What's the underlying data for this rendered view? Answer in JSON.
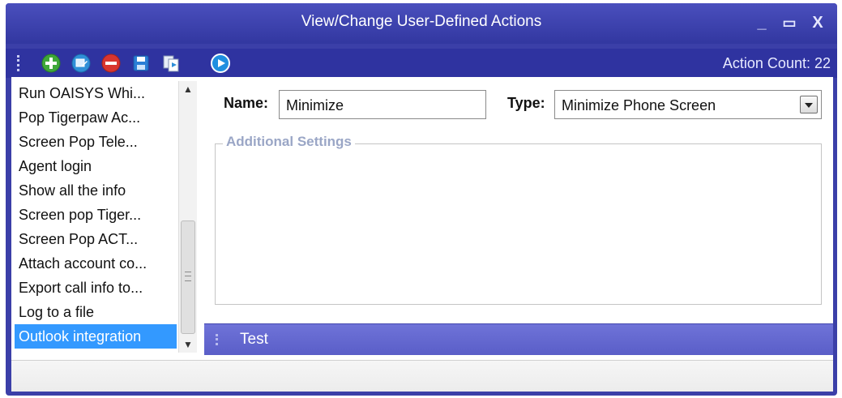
{
  "window": {
    "title": "View/Change User-Defined Actions",
    "buttons": {
      "minimize": "_",
      "maximize": "▭",
      "close": "X"
    }
  },
  "toolbar": {
    "icons": [
      "add-icon",
      "edit-icon",
      "delete-icon",
      "save-icon",
      "copy-icon",
      "run-icon"
    ],
    "action_count": "Action Count: 22"
  },
  "actions_list": {
    "items": [
      "Run OAISYS Whi...",
      "Pop Tigerpaw Ac...",
      "Screen Pop Tele...",
      "Agent login",
      "Show all the info",
      "Screen pop Tiger...",
      "Screen Pop ACT...",
      "Attach account co...",
      "Export call info to...",
      "Log to a file",
      "Outlook integration"
    ],
    "selected": "Outlook integration"
  },
  "details": {
    "name_label": "Name:",
    "name_value": "Minimize",
    "type_label": "Type:",
    "type_value": "Minimize Phone Screen",
    "additional_settings_label": "Additional Settings"
  },
  "test_bar": {
    "label": "Test"
  },
  "colors": {
    "titlebar": "#3b3fa8",
    "selection": "#3399ff",
    "test_bar": "#6467d3",
    "group_label": "#9aa6c6"
  }
}
